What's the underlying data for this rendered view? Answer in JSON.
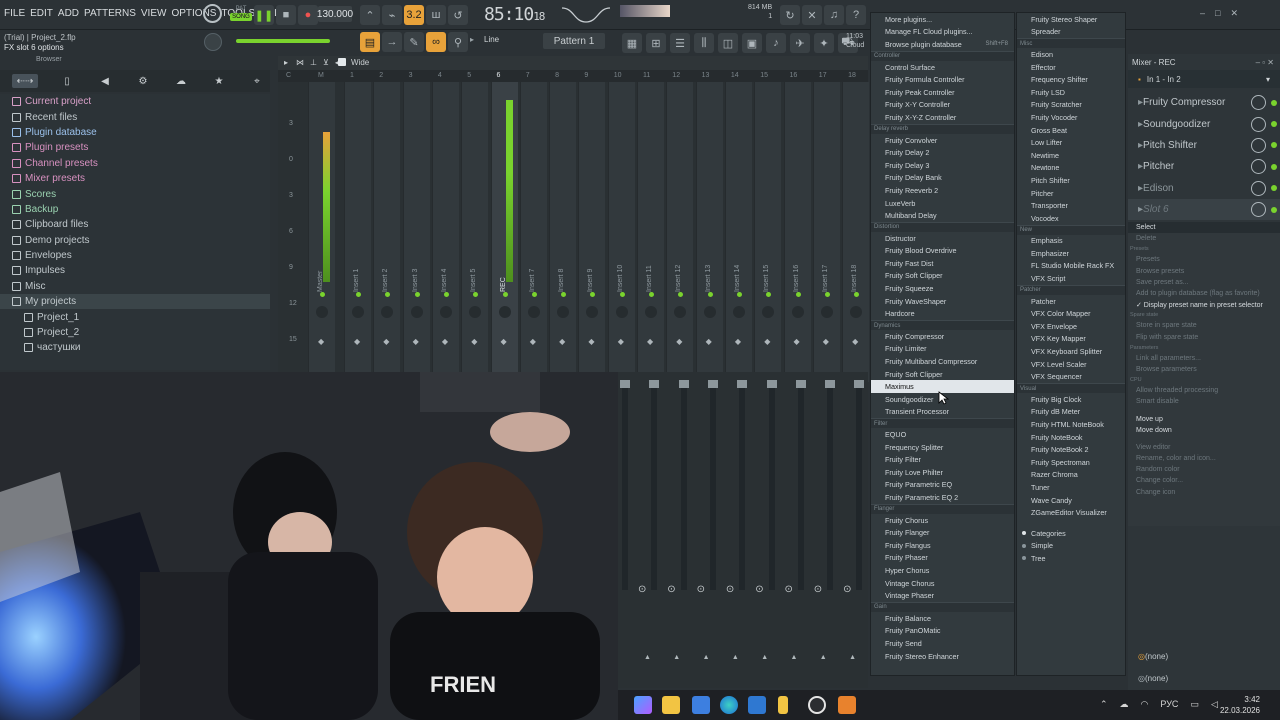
{
  "menubar": {
    "items": [
      "FILE",
      "EDIT",
      "ADD",
      "PATTERNS",
      "VIEW",
      "OPTIONS",
      "TOOLS",
      "HELP"
    ]
  },
  "transport": {
    "pat": "PAT",
    "song": "SONG",
    "tempo": "130.000",
    "time": "85:10",
    "time_sub": "18",
    "time_unit": "B:S:T",
    "memory": "814 MB",
    "cpu": "1",
    "step": "3.2"
  },
  "project": {
    "title": "(Trial)  |  Project_2.flp",
    "hint": "FX slot 6 options"
  },
  "toolbar": {
    "line_mode": "Line",
    "pattern": "Pattern 1",
    "clock": "11:03",
    "cloud": "Cloud"
  },
  "browser": {
    "title": "Browser",
    "items": [
      {
        "label": "Current project",
        "color": "#d8a0c8"
      },
      {
        "label": "Recent files",
        "color": "#c0c8cc"
      },
      {
        "label": "Plugin database",
        "color": "#9bc0ea"
      },
      {
        "label": "Plugin presets",
        "color": "#d891c0"
      },
      {
        "label": "Channel presets",
        "color": "#d891c0"
      },
      {
        "label": "Mixer presets",
        "color": "#d891c0"
      },
      {
        "label": "Scores",
        "color": "#9ad2b0"
      },
      {
        "label": "Backup",
        "color": "#9ad2b0"
      },
      {
        "label": "Clipboard files",
        "color": "#c0c8cc"
      },
      {
        "label": "Demo projects",
        "color": "#c0c8cc"
      },
      {
        "label": "Envelopes",
        "color": "#c0c8cc"
      },
      {
        "label": "Impulses",
        "color": "#c0c8cc"
      },
      {
        "label": "Misc",
        "color": "#c0c8cc"
      },
      {
        "label": "My projects",
        "color": "#c0c8cc",
        "selected": true
      },
      {
        "label": "Project_1",
        "color": "#c0c8cc",
        "indent": true
      },
      {
        "label": "Project_2",
        "color": "#c0c8cc",
        "indent": true
      },
      {
        "label": "частушки",
        "color": "#c0c8cc",
        "indent": true
      }
    ]
  },
  "mixer": {
    "view": "Wide",
    "ruler": [
      "C",
      "M",
      "1",
      "2",
      "3",
      "4",
      "5",
      "6",
      "7",
      "8",
      "9",
      "10",
      "11",
      "12",
      "13",
      "14",
      "15",
      "16",
      "17",
      "18"
    ],
    "db_scale": [
      "3",
      "0",
      "3",
      "6",
      "9",
      "12",
      "15",
      "18"
    ],
    "tracks": [
      "Master",
      "Insert 1",
      "Insert 2",
      "Insert 3",
      "Insert 4",
      "Insert 5",
      "REC",
      "Insert 7",
      "Insert 8",
      "Insert 9",
      "Insert 10",
      "Insert 11",
      "Insert 12",
      "Insert 13",
      "Insert 14",
      "Insert 15",
      "Insert 16",
      "Insert 17",
      "Insert 18"
    ]
  },
  "plugin_menu": {
    "col1": [
      {
        "t": "item",
        "label": "More plugins..."
      },
      {
        "t": "item",
        "label": "Manage FL Cloud plugins..."
      },
      {
        "t": "item",
        "label": "Browse plugin database",
        "shortcut": "Shift+F8"
      },
      {
        "t": "head",
        "label": "Controller"
      },
      {
        "t": "item",
        "label": "Control Surface"
      },
      {
        "t": "item",
        "label": "Fruity Formula Controller"
      },
      {
        "t": "item",
        "label": "Fruity Peak Controller"
      },
      {
        "t": "item",
        "label": "Fruity X-Y Controller"
      },
      {
        "t": "item",
        "label": "Fruity X-Y-Z Controller"
      },
      {
        "t": "head",
        "label": "Delay reverb"
      },
      {
        "t": "item",
        "label": "Fruity Convolver"
      },
      {
        "t": "item",
        "label": "Fruity Delay 2"
      },
      {
        "t": "item",
        "label": "Fruity Delay 3"
      },
      {
        "t": "item",
        "label": "Fruity Delay Bank"
      },
      {
        "t": "item",
        "label": "Fruity Reeverb 2"
      },
      {
        "t": "item",
        "label": "LuxeVerb"
      },
      {
        "t": "item",
        "label": "Multiband Delay"
      },
      {
        "t": "head",
        "label": "Distortion"
      },
      {
        "t": "item",
        "label": "Distructor"
      },
      {
        "t": "item",
        "label": "Fruity Blood Overdrive"
      },
      {
        "t": "item",
        "label": "Fruity Fast Dist"
      },
      {
        "t": "item",
        "label": "Fruity Soft Clipper"
      },
      {
        "t": "item",
        "label": "Fruity Squeeze"
      },
      {
        "t": "item",
        "label": "Fruity WaveShaper"
      },
      {
        "t": "item",
        "label": "Hardcore"
      },
      {
        "t": "head",
        "label": "Dynamics"
      },
      {
        "t": "item",
        "label": "Fruity Compressor"
      },
      {
        "t": "item",
        "label": "Fruity Limiter"
      },
      {
        "t": "item",
        "label": "Fruity Multiband Compressor"
      },
      {
        "t": "item",
        "label": "Fruity Soft Clipper"
      },
      {
        "t": "item",
        "label": "Maximus",
        "highlight": true
      },
      {
        "t": "item",
        "label": "Soundgoodizer"
      },
      {
        "t": "item",
        "label": "Transient Processor"
      },
      {
        "t": "head",
        "label": "Filter"
      },
      {
        "t": "item",
        "label": "EQUO"
      },
      {
        "t": "item",
        "label": "Frequency Splitter"
      },
      {
        "t": "item",
        "label": "Fruity Filter"
      },
      {
        "t": "item",
        "label": "Fruity Love Philter"
      },
      {
        "t": "item",
        "label": "Fruity Parametric EQ"
      },
      {
        "t": "item",
        "label": "Fruity Parametric EQ 2"
      },
      {
        "t": "head",
        "label": "Flanger"
      },
      {
        "t": "item",
        "label": "Fruity Chorus"
      },
      {
        "t": "item",
        "label": "Fruity Flanger"
      },
      {
        "t": "item",
        "label": "Fruity Flangus"
      },
      {
        "t": "item",
        "label": "Fruity Phaser"
      },
      {
        "t": "item",
        "label": "Hyper Chorus"
      },
      {
        "t": "item",
        "label": "Vintage Chorus"
      },
      {
        "t": "item",
        "label": "Vintage Phaser"
      },
      {
        "t": "head",
        "label": "Gain"
      },
      {
        "t": "item",
        "label": "Fruity Balance"
      },
      {
        "t": "item",
        "label": "Fruity PanOMatic"
      },
      {
        "t": "item",
        "label": "Fruity Send"
      },
      {
        "t": "item",
        "label": "Fruity Stereo Enhancer"
      }
    ],
    "col2": [
      {
        "t": "item",
        "label": "Fruity Stereo Shaper"
      },
      {
        "t": "item",
        "label": "Spreader"
      },
      {
        "t": "head",
        "label": "Misc"
      },
      {
        "t": "item",
        "label": "Edison"
      },
      {
        "t": "item",
        "label": "Effector"
      },
      {
        "t": "item",
        "label": "Frequency Shifter"
      },
      {
        "t": "item",
        "label": "Fruity LSD"
      },
      {
        "t": "item",
        "label": "Fruity Scratcher"
      },
      {
        "t": "item",
        "label": "Fruity Vocoder"
      },
      {
        "t": "item",
        "label": "Gross Beat"
      },
      {
        "t": "item",
        "label": "Low Lifter"
      },
      {
        "t": "item",
        "label": "Newtime"
      },
      {
        "t": "item",
        "label": "Newtone"
      },
      {
        "t": "item",
        "label": "Pitch Shifter"
      },
      {
        "t": "item",
        "label": "Pitcher"
      },
      {
        "t": "item",
        "label": "Transporter"
      },
      {
        "t": "item",
        "label": "Vocodex"
      },
      {
        "t": "head",
        "label": "New"
      },
      {
        "t": "item",
        "label": "Emphasis"
      },
      {
        "t": "item",
        "label": "Emphasizer"
      },
      {
        "t": "item",
        "label": "FL Studio Mobile Rack FX"
      },
      {
        "t": "item",
        "label": "VFX Script"
      },
      {
        "t": "head",
        "label": "Patcher"
      },
      {
        "t": "item",
        "label": "Patcher"
      },
      {
        "t": "item",
        "label": "VFX Color Mapper"
      },
      {
        "t": "item",
        "label": "VFX Envelope"
      },
      {
        "t": "item",
        "label": "VFX Key Mapper"
      },
      {
        "t": "item",
        "label": "VFX Keyboard Splitter"
      },
      {
        "t": "item",
        "label": "VFX Level Scaler"
      },
      {
        "t": "item",
        "label": "VFX Sequencer"
      },
      {
        "t": "head",
        "label": "Visual"
      },
      {
        "t": "item",
        "label": "Fruity Big Clock"
      },
      {
        "t": "item",
        "label": "Fruity dB Meter"
      },
      {
        "t": "item",
        "label": "Fruity HTML NoteBook"
      },
      {
        "t": "item",
        "label": "Fruity NoteBook"
      },
      {
        "t": "item",
        "label": "Fruity NoteBook 2"
      },
      {
        "t": "item",
        "label": "Fruity Spectroman"
      },
      {
        "t": "item",
        "label": "Razer Chroma"
      },
      {
        "t": "item",
        "label": "Tuner"
      },
      {
        "t": "item",
        "label": "Wave Candy"
      },
      {
        "t": "item",
        "label": "ZGameEditor Visualizer"
      },
      {
        "t": "sep"
      },
      {
        "t": "radio",
        "label": "Categories",
        "on": true
      },
      {
        "t": "radio",
        "label": "Simple"
      },
      {
        "t": "radio",
        "label": "Tree"
      }
    ]
  },
  "insert_panel": {
    "title": "Mixer - REC",
    "input": "In 1 - In 2",
    "slots": [
      "Fruity Compressor",
      "Soundgoodizer",
      "Pitch Shifter",
      "Pitcher",
      "Edison",
      "Slot 6"
    ],
    "bottom": [
      "(none)",
      "(none)"
    ]
  },
  "slot_menu": [
    {
      "t": "item",
      "label": "Select",
      "hl": true
    },
    {
      "t": "dis",
      "label": "Delete"
    },
    {
      "t": "head",
      "label": "Presets"
    },
    {
      "t": "dis",
      "label": "Presets"
    },
    {
      "t": "dis",
      "label": "Browse presets"
    },
    {
      "t": "dis",
      "label": "Save preset as..."
    },
    {
      "t": "dis",
      "label": "Add to plugin database (flag as favorite)"
    },
    {
      "t": "item",
      "label": "✓ Display preset name in preset selector"
    },
    {
      "t": "head",
      "label": "Spare state"
    },
    {
      "t": "dis",
      "label": "Store in spare state"
    },
    {
      "t": "dis",
      "label": "Flip with spare state"
    },
    {
      "t": "head",
      "label": "Parameters"
    },
    {
      "t": "dis",
      "label": "Link all parameters..."
    },
    {
      "t": "dis",
      "label": "Browse parameters"
    },
    {
      "t": "head",
      "label": "CPU"
    },
    {
      "t": "dis",
      "label": "Allow threaded processing"
    },
    {
      "t": "dis",
      "label": "Smart disable"
    },
    {
      "t": "gap"
    },
    {
      "t": "item",
      "label": "Move up"
    },
    {
      "t": "item",
      "label": "Move down"
    },
    {
      "t": "gap"
    },
    {
      "t": "dis",
      "label": "View editor"
    },
    {
      "t": "dis",
      "label": "Rename, color and icon..."
    },
    {
      "t": "dis",
      "label": "Random color"
    },
    {
      "t": "dis",
      "label": "Change color..."
    },
    {
      "t": "dis",
      "label": "Change icon"
    }
  ],
  "taskbar": {
    "lang": "РУС",
    "time": "3:42",
    "date": "22.03.2026"
  }
}
